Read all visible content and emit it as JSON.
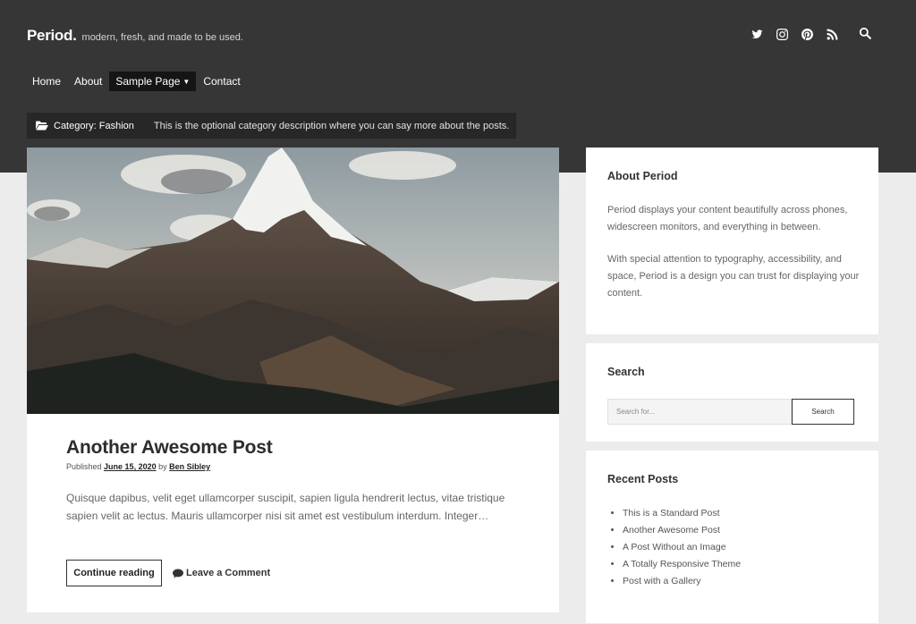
{
  "header": {
    "site_title": "Period.",
    "tagline": "modern, fresh, and made to be used.",
    "social_icons": [
      "twitter-icon",
      "instagram-icon",
      "pinterest-icon",
      "rss-icon"
    ],
    "search_icon": "search-icon"
  },
  "nav": {
    "items": [
      {
        "label": "Home"
      },
      {
        "label": "About"
      },
      {
        "label": "Sample Page",
        "has_dropdown": true
      },
      {
        "label": "Contact"
      }
    ]
  },
  "category": {
    "label": "Category: Fashion",
    "description": "This is the optional category description where you can say more about the posts."
  },
  "post": {
    "title": "Another Awesome Post",
    "meta_prefix": "Published",
    "date": "June 15, 2020",
    "meta_by": "by",
    "author": "Ben Sibley",
    "excerpt": "Quisque dapibus, velit eget ullamcorper suscipit, sapien ligula hendrerit lectus, vitae tristique sapien velit ac lectus. Mauris ullamcorper nisi sit amet est vestibulum interdum. Integer…",
    "continue_label": "Continue reading",
    "comment_label": "Leave a Comment"
  },
  "sidebar": {
    "about": {
      "title": "About Period",
      "p1": "Period displays your content beautifully across phones, widescreen monitors, and everything in between.",
      "p2": "With special attention to typography, accessibility, and space, Period is a design you can trust for displaying your content."
    },
    "search": {
      "title": "Search",
      "placeholder": "Search for...",
      "button_label": "Search"
    },
    "recent": {
      "title": "Recent Posts",
      "items": [
        "This is a Standard Post",
        "Another Awesome Post",
        "A Post Without an Image",
        "A Totally Responsive Theme",
        "Post with a Gallery"
      ]
    }
  },
  "colors": {
    "header_bg": "#363636",
    "page_bg": "#ececec",
    "category_bar_bg": "#272727"
  }
}
